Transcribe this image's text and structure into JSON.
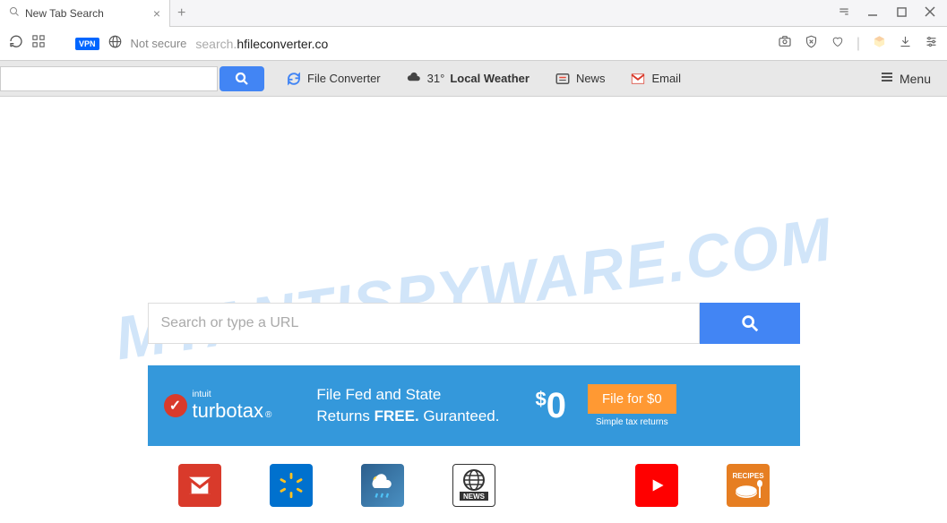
{
  "tab": {
    "title": "New Tab Search"
  },
  "address": {
    "vpn_label": "VPN",
    "security": "Not secure",
    "url_prefix": "search.",
    "url_main": "hfileconverter.co"
  },
  "toolbar": {
    "file_converter": "File Converter",
    "weather_temp": "31°",
    "weather_label": "Local Weather",
    "news": "News",
    "email": "Email",
    "menu": "Menu"
  },
  "watermark": "MYANTISPYWARE.COM",
  "main_search": {
    "placeholder": "Search or type a URL"
  },
  "ad": {
    "brand_small": "intuit",
    "brand_main": "turbotax",
    "line1": "File Fed and State",
    "line2_a": "Returns ",
    "line2_b": "FREE.",
    "line2_c": " Guranteed.",
    "price": "0",
    "cta": "File for $0",
    "cta_sub": "Simple tax returns"
  },
  "icons": {
    "recipes_label": "RECIPES",
    "news_label": "NEWS"
  }
}
